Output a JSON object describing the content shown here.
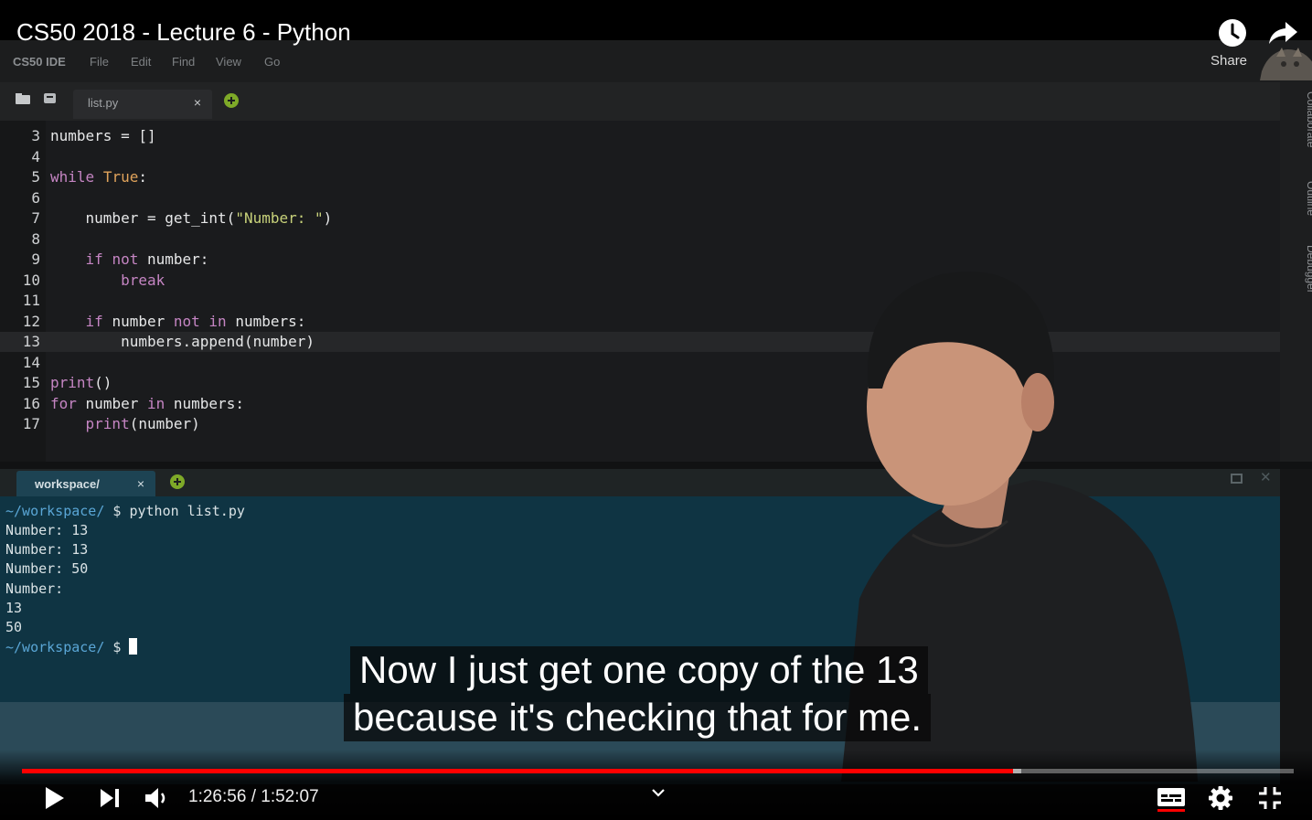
{
  "video": {
    "title": "CS50 2018 - Lecture 6 - Python",
    "share_label": "Share",
    "time_current": "1:26:56",
    "time_separator": "/",
    "time_total": "1:52:07",
    "progress_played_fraction": 0.779,
    "progress_buffered_fraction": 0.786
  },
  "ide": {
    "brand": "CS50 IDE",
    "menu": [
      "File",
      "Edit",
      "Find",
      "View",
      "Go"
    ],
    "editor_tab": {
      "label": "list.py",
      "close": "×"
    },
    "side_panel": [
      "Collaborate",
      "Outline",
      "Debugger"
    ],
    "code_lines": [
      {
        "n": "3",
        "code": "numbers = []"
      },
      {
        "n": "4",
        "code": ""
      },
      {
        "n": "5",
        "code": "while True:"
      },
      {
        "n": "6",
        "code": ""
      },
      {
        "n": "7",
        "code": "    number = get_int(\"Number: \")"
      },
      {
        "n": "8",
        "code": ""
      },
      {
        "n": "9",
        "code": "    if not number:"
      },
      {
        "n": "10",
        "code": "        break"
      },
      {
        "n": "11",
        "code": ""
      },
      {
        "n": "12",
        "code": "    if number not in numbers:"
      },
      {
        "n": "13",
        "code": "        numbers.append(number)"
      },
      {
        "n": "14",
        "code": ""
      },
      {
        "n": "15",
        "code": "print()"
      },
      {
        "n": "16",
        "code": "for number in numbers:"
      },
      {
        "n": "17",
        "code": "    print(number)"
      }
    ],
    "terminal_tab": {
      "label": "workspace/",
      "close": "×"
    },
    "terminal": {
      "prompt_path": "~/workspace/",
      "prompt_symbol": "$",
      "command": "python list.py",
      "output": [
        "Number: 13",
        "Number: 13",
        "Number: 50",
        "Number:",
        "13",
        "50"
      ]
    }
  },
  "captions": [
    "Now I just get one copy of the 13",
    "because it's checking that for me."
  ],
  "colors": {
    "progress_played": "#ff0000",
    "keyword": "#c585c3",
    "constant": "#e0a35b",
    "string": "#c8d27a",
    "prompt_path": "#5aa6d6"
  },
  "icons": {
    "top_right": [
      "watch-later-icon",
      "share-icon"
    ],
    "controls_left": [
      "play-icon",
      "next-icon",
      "volume-icon"
    ],
    "controls_right": [
      "subtitles-icon",
      "settings-icon",
      "exit-fullscreen-icon"
    ]
  }
}
